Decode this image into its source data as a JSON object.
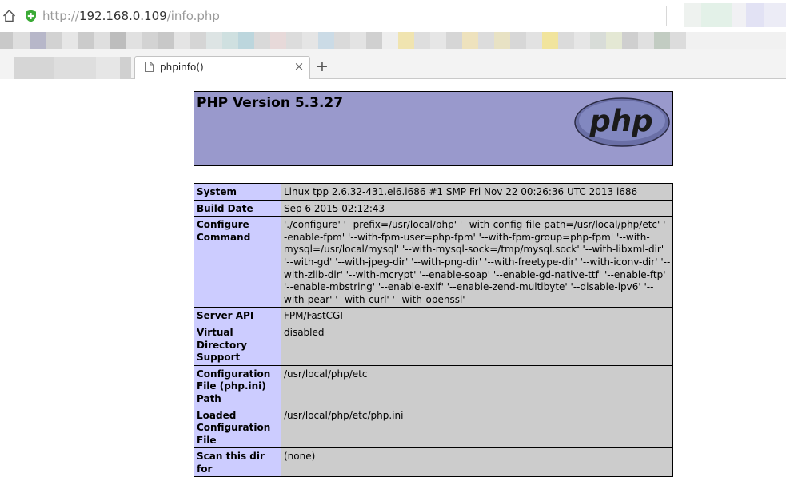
{
  "browser": {
    "url_scheme": "http://",
    "url_host": "192.168.0.109",
    "url_path": "/info.php",
    "tab_title": "phpinfo()",
    "tab_close": "×",
    "new_tab": "+"
  },
  "php": {
    "version_title": "PHP Version 5.3.27",
    "logo_text": "php"
  },
  "rows": [
    {
      "name": "System",
      "value": "Linux tpp 2.6.32-431.el6.i686 #1 SMP Fri Nov 22 00:26:36 UTC 2013 i686"
    },
    {
      "name": "Build Date",
      "value": "Sep 6 2015 02:12:43"
    },
    {
      "name": "Configure Command",
      "value": "'./configure' '--prefix=/usr/local/php' '--with-config-file-path=/usr/local/php/etc' '--enable-fpm' '--with-fpm-user=php-fpm' '--with-fpm-group=php-fpm' '--with-mysql=/usr/local/mysql' '--with-mysql-sock=/tmp/mysql.sock' '--with-libxml-dir' '--with-gd' '--with-jpeg-dir' '--with-png-dir' '--with-freetype-dir' '--with-iconv-dir' '--with-zlib-dir' '--with-mcrypt' '--enable-soap' '--enable-gd-native-ttf' '--enable-ftp' '--enable-mbstring' '--enable-exif' '--enable-zend-multibyte' '--disable-ipv6' '--with-pear' '--with-curl' '--with-openssl'"
    },
    {
      "name": "Server API",
      "value": "FPM/FastCGI"
    },
    {
      "name": "Virtual Directory Support",
      "value": "disabled"
    },
    {
      "name": "Configuration File (php.ini) Path",
      "value": "/usr/local/php/etc"
    },
    {
      "name": "Loaded Configuration File",
      "value": "/usr/local/php/etc/php.ini"
    },
    {
      "name": "Scan this dir for",
      "value": "(none)"
    }
  ],
  "colors": {
    "header_bg": "#9999cc",
    "label_cell_bg": "#ccccff",
    "value_cell_bg": "#cccccc",
    "shield_green": "#3aaa35"
  }
}
